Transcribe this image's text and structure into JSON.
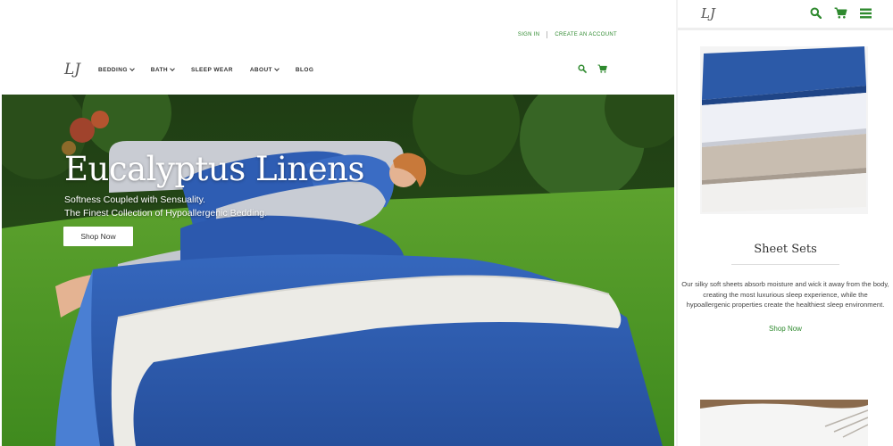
{
  "desktop": {
    "topbar": {
      "sign_in": "SIGN IN",
      "create_account": "CREATE AN ACCOUNT"
    },
    "logo_text": "LJ",
    "nav": {
      "items": [
        {
          "label": "BEDDING",
          "has_dropdown": true
        },
        {
          "label": "BATH",
          "has_dropdown": true
        },
        {
          "label": "SLEEP WEAR",
          "has_dropdown": false
        },
        {
          "label": "ABOUT",
          "has_dropdown": true
        },
        {
          "label": "BLOG",
          "has_dropdown": false
        }
      ],
      "icons": [
        "search-icon",
        "cart-icon"
      ]
    },
    "hero": {
      "title": "Eucalyptus Linens",
      "subtitle_line1": "Softness Coupled with Sensuality.",
      "subtitle_line2": "The Finest Collection of Hypoallergenic Bedding.",
      "button": "Shop Now"
    }
  },
  "mobile": {
    "logo_text": "LJ",
    "icons": [
      "search-icon",
      "cart-icon",
      "menu-icon"
    ],
    "section": {
      "title": "Sheet Sets",
      "description": "Our silky soft sheets absorb moisture and wick it away from the body, creating the most luxurious sleep experience, while the hypoallergenic properties create the healthiest sleep environment.",
      "link": "Shop Now"
    }
  },
  "colors": {
    "accent_green": "#2f8a2f",
    "bedding_blue": "#2f5fb0",
    "grass_green": "#4f9a2a"
  }
}
